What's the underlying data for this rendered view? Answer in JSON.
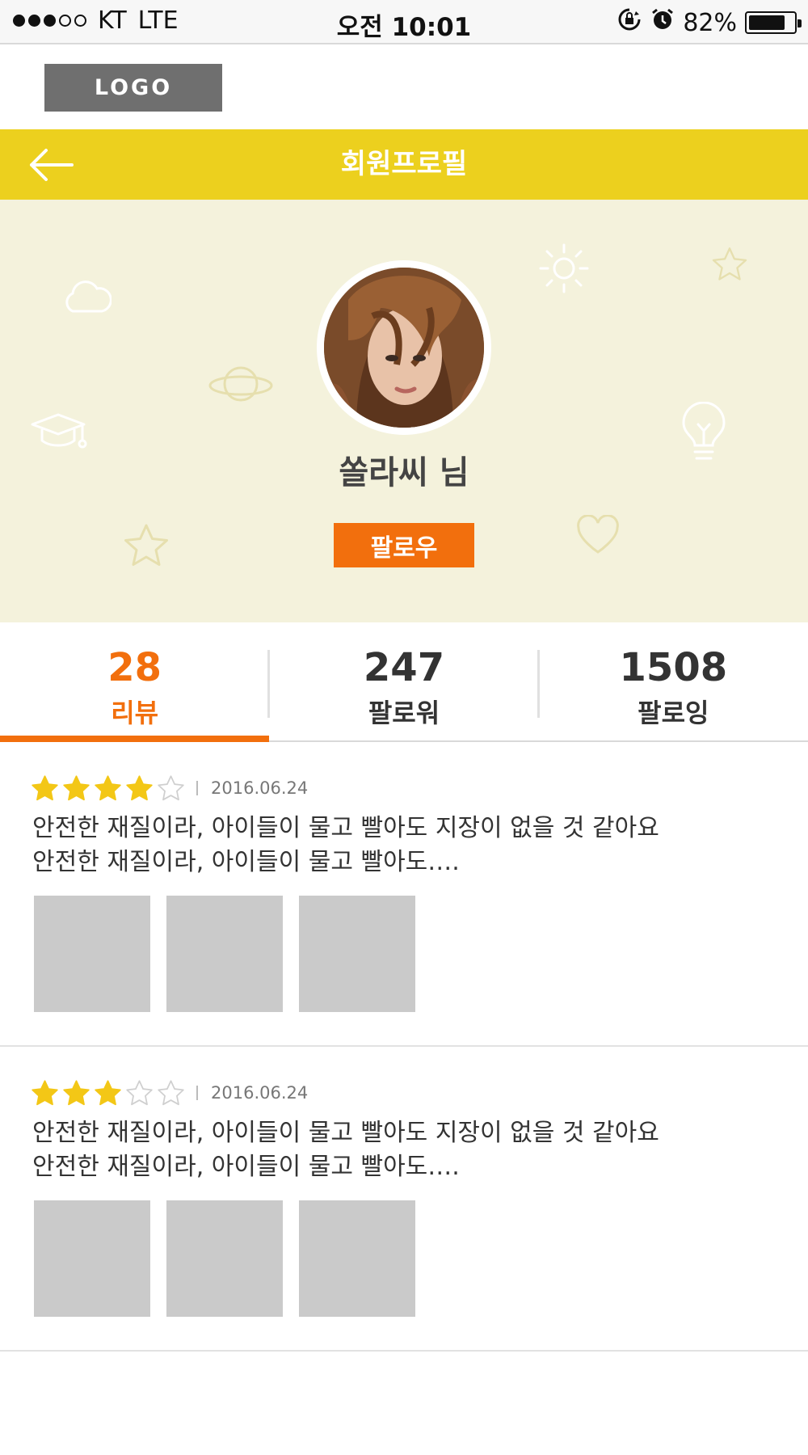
{
  "status_bar": {
    "carrier": "KT",
    "network": "LTE",
    "time": "오전 10:01",
    "battery": "82%",
    "battery_level": 0.82,
    "signal_full": 3,
    "signal_total": 5
  },
  "header": {
    "logo": "LOGO",
    "title": "회원프로필",
    "back_icon": "arrow-left-icon"
  },
  "profile": {
    "name": "쏠라씨 님",
    "follow_label": "팔로우"
  },
  "stats": [
    {
      "count": "28",
      "label": "리뷰",
      "active": true
    },
    {
      "count": "247",
      "label": "팔로워",
      "active": false
    },
    {
      "count": "1508",
      "label": "팔로잉",
      "active": false
    }
  ],
  "reviews": [
    {
      "rating": 4,
      "max_rating": 5,
      "date": "2016.06.24",
      "text_line1": "안전한 재질이라, 아이들이 물고 빨아도 지장이 없을 것 같아요",
      "text_line2": "안전한 재질이라, 아이들이 물고 빨아도….",
      "photo_count": 3
    },
    {
      "rating": 3,
      "max_rating": 5,
      "date": "2016.06.24",
      "text_line1": "안전한 재질이라, 아이들이 물고 빨아도 지장이 없을 것 같아요",
      "text_line2": "안전한 재질이라, 아이들이 물고 빨아도….",
      "photo_count": 3
    }
  ],
  "colors": {
    "header_bg": "#ecd01e",
    "accent": "#f26f0d",
    "hero_bg": "#f4f2dc",
    "star_filled": "#f3c716",
    "thumb_placeholder": "#cacaca"
  }
}
